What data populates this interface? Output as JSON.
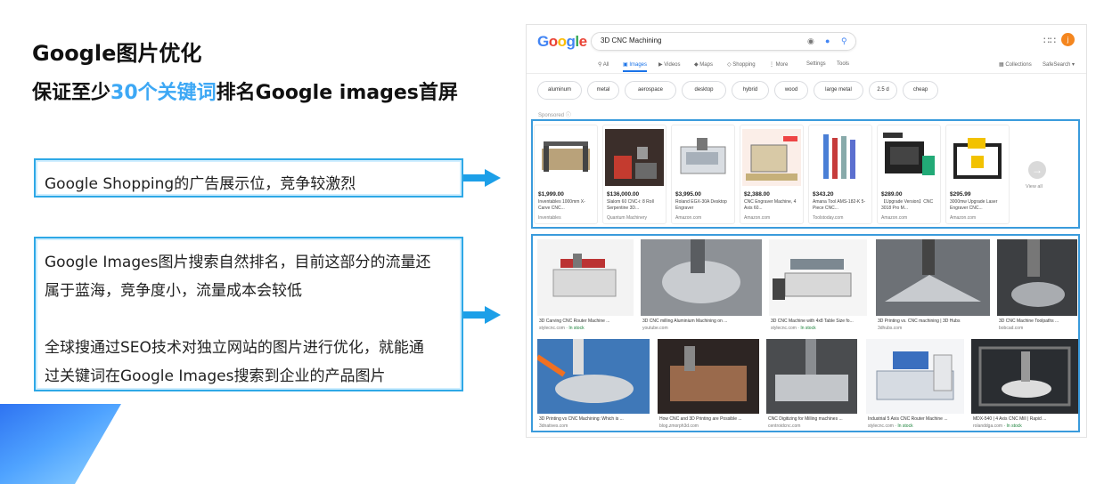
{
  "slide": {
    "title_line1": "Google图片优化",
    "title_line2_pre": "保证至少",
    "title_line2_highlight": "30个关键词",
    "title_line2_post": "排名Google images首屏",
    "box1_text": "Google Shopping的广告展示位，竞争较激烈",
    "box2_lines": [
      "Google Images图片搜索自然排名，目前这部分的流量还",
      "属于蓝海，竞争度小，流量成本会较低",
      "全球搜通过SEO技术对独立网站的图片进行优化，就能通",
      "过关键词在Google Images搜索到企业的产品图片"
    ],
    "colors": {
      "highlight": "#3da8f5",
      "frame": "#2ea8e6",
      "arrow": "#1c9fe8"
    }
  },
  "google": {
    "logo_letters": [
      "G",
      "o",
      "o",
      "g",
      "l",
      "e"
    ],
    "logo_colors": [
      "#4285f4",
      "#ea4335",
      "#fbbc05",
      "#4285f4",
      "#34a853",
      "#ea4335"
    ],
    "query": "3D CNC Machining",
    "avatar_letter": "j",
    "tabs": {
      "all": "All",
      "images": "Images",
      "videos": "Videos",
      "maps": "Maps",
      "shopping": "Shopping",
      "more": "More",
      "settings": "Settings",
      "tools": "Tools",
      "collections": "Collections",
      "safesearch": "SafeSearch ▾"
    },
    "chips": [
      "aluminum",
      "metal",
      "aerospace",
      "desktop",
      "hybrid",
      "wood",
      "large metal",
      "2.5 d",
      "cheap"
    ],
    "sponsored": "Sponsored ⓘ",
    "view_all": "View all",
    "shopping": [
      {
        "price": "$1,999.00",
        "name": "Inventables 1000mm X-Carve CNC...",
        "store": "Inventables"
      },
      {
        "price": "$136,000.00",
        "name": "Slalom 60 CNC-i: 8 Roll Serpentine 3D...",
        "store": "Quantum Machinery"
      },
      {
        "price": "$3,995.00",
        "name": "Roland EGX-30A Desktop Engraver",
        "store": "Amazon.com"
      },
      {
        "price": "$2,388.00",
        "name": "CNC Engraver Machine, 4 Axis 60...",
        "store": "Amazon.com"
      },
      {
        "price": "$343.20",
        "name": "Amana Tool AMS-182-K 5-Piece CNC...",
        "store": "Toolstoday.com"
      },
      {
        "price": "$289.00",
        "name": "【Upgrade Version】CNC 3018 Pro M...",
        "store": "Amazon.com"
      },
      {
        "price": "$295.99",
        "name": "3000mw Upgrade Laser Engraver CNC...",
        "store": "Amazon.com"
      }
    ],
    "images_row1": [
      {
        "cap": "3D Carving CNC Router Machine ...",
        "src": "stylecnc.com",
        "stock": "· In stock"
      },
      {
        "cap": "3D CNC milling Aluminium Machining on ...",
        "src": "youtube.com",
        "stock": ""
      },
      {
        "cap": "3D CNC Machine with 4x8 Table Size fo...",
        "src": "stylecnc.com",
        "stock": "· In stock"
      },
      {
        "cap": "3D Printing vs. CNC machining | 3D Hubs",
        "src": "3dhubs.com",
        "stock": ""
      },
      {
        "cap": "3D CNC Machine Toolpaths ...",
        "src": "bobcad.com",
        "stock": ""
      }
    ],
    "images_row2": [
      {
        "cap": "3D Printing vs CNC Machining: Which is ...",
        "src": "3dnatives.com",
        "stock": ""
      },
      {
        "cap": "How CNC and 3D Printing are Possible ...",
        "src": "blog.zmorph3d.com",
        "stock": ""
      },
      {
        "cap": "CNC Digitizing for Milling machines ...",
        "src": "centroidcnc.com",
        "stock": ""
      },
      {
        "cap": "Industrial 5 Axis CNC Router Machine ...",
        "src": "stylecnc.com",
        "stock": "· In stock"
      },
      {
        "cap": "MDX-540 | 4 Axis CNC Mill | Rapid ...",
        "src": "rolanddga.com",
        "stock": "· In stock"
      }
    ]
  }
}
